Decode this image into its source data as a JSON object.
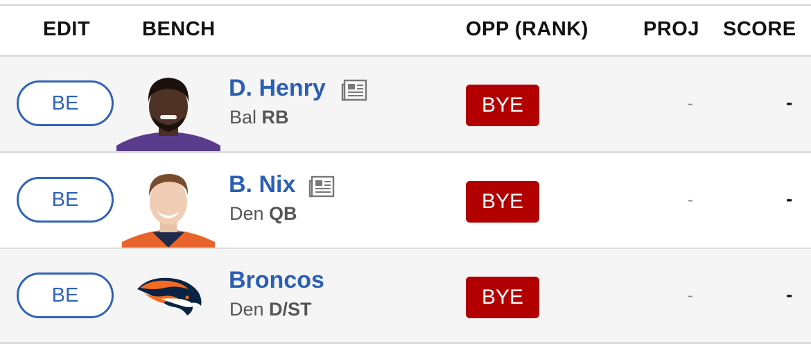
{
  "columns": {
    "edit": "EDIT",
    "bench": "BENCH",
    "opp": "OPP (RANK)",
    "proj": "PROJ",
    "score": "SCORE"
  },
  "rows": [
    {
      "slot": "BE",
      "name": "D. Henry",
      "team": "Bal",
      "position": "RB",
      "opponent": "BYE",
      "proj": "-",
      "score": "-",
      "image": "player-headshot",
      "jersey_color": "#5a3c8c",
      "has_news": true
    },
    {
      "slot": "BE",
      "name": "B. Nix",
      "team": "Den",
      "position": "QB",
      "opponent": "BYE",
      "proj": "-",
      "score": "-",
      "image": "player-headshot",
      "jersey_color": "#e8642b",
      "has_news": true
    },
    {
      "slot": "BE",
      "name": "Broncos",
      "team": "Den",
      "position": "D/ST",
      "opponent": "BYE",
      "proj": "-",
      "score": "-",
      "image": "team-logo",
      "has_news": false
    }
  ],
  "colors": {
    "link_blue": "#2b5fb3",
    "button_border": "#2f63b5",
    "bye_red": "#b20000",
    "row_alt": "#f5f5f6"
  }
}
